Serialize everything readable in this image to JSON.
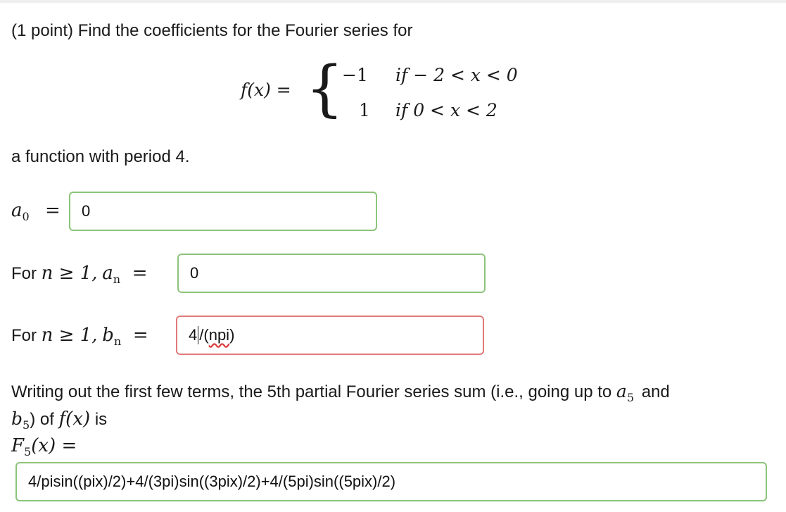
{
  "problem": {
    "intro": "(1 point) Find the coefficients for the Fourier series for",
    "period_text": "a function with period 4."
  },
  "piecewise": {
    "lhs": "f(x) =",
    "case1_value": "−1",
    "case1_cond": "if  − 2 < x < 0",
    "case2_value": "1",
    "case2_cond": "if 0 < x < 2"
  },
  "a0": {
    "label": "a",
    "label_sub": "0",
    "equals": "=",
    "value": "0"
  },
  "an": {
    "prefix": "For",
    "condition": "n ≥ 1,",
    "label": "a",
    "label_sub": "n",
    "equals": "=",
    "value": "0"
  },
  "bn": {
    "prefix": "For",
    "condition": "n ≥ 1,",
    "label": "b",
    "label_sub": "n",
    "equals": "=",
    "value_part1": "4",
    "value_part2": "/(",
    "value_part3": "npi",
    "value_part4": ")"
  },
  "partial_sum": {
    "line1_text": "Writing out the first few terms, the 5th partial Fourier series sum (i.e., going up to",
    "line1_var": "a",
    "line1_var_sub": "5",
    "line1_and": "and",
    "line2_var": "b",
    "line2_var_sub": "5",
    "line2_text": ") of",
    "line2_fx": "f(x)",
    "line2_is": "is",
    "line3_label": "F",
    "line3_sub": "5",
    "line3_rest": "(x) =",
    "value": "4/pisin((pix)/2)+4/(3pi)sin((3pix)/2)+4/(5pi)sin((5pix)/2)"
  },
  "colors": {
    "correct_border": "#8cc47a",
    "incorrect_border": "#e07a7a"
  }
}
